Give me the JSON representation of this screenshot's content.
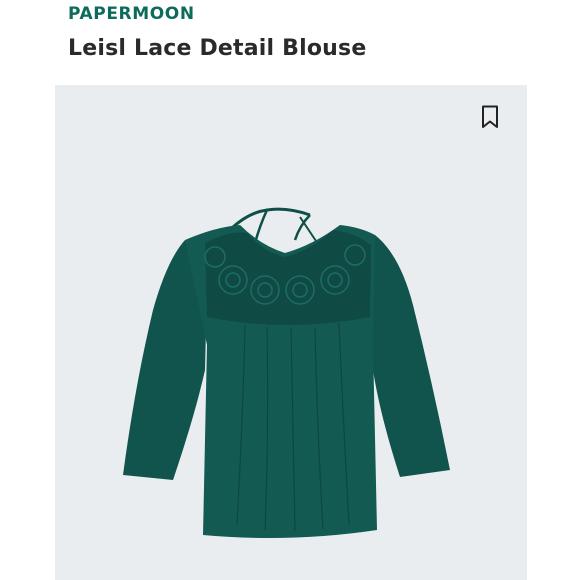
{
  "product": {
    "brand": "PAPERMOON",
    "title": "Leisl Lace Detail Blouse"
  },
  "icons": {
    "bookmark": "bookmark-icon"
  },
  "colors": {
    "brand": "#0d6b5c",
    "title": "#2a2a2a",
    "photo_background": "#eaedf0",
    "garment": "#11544e"
  }
}
